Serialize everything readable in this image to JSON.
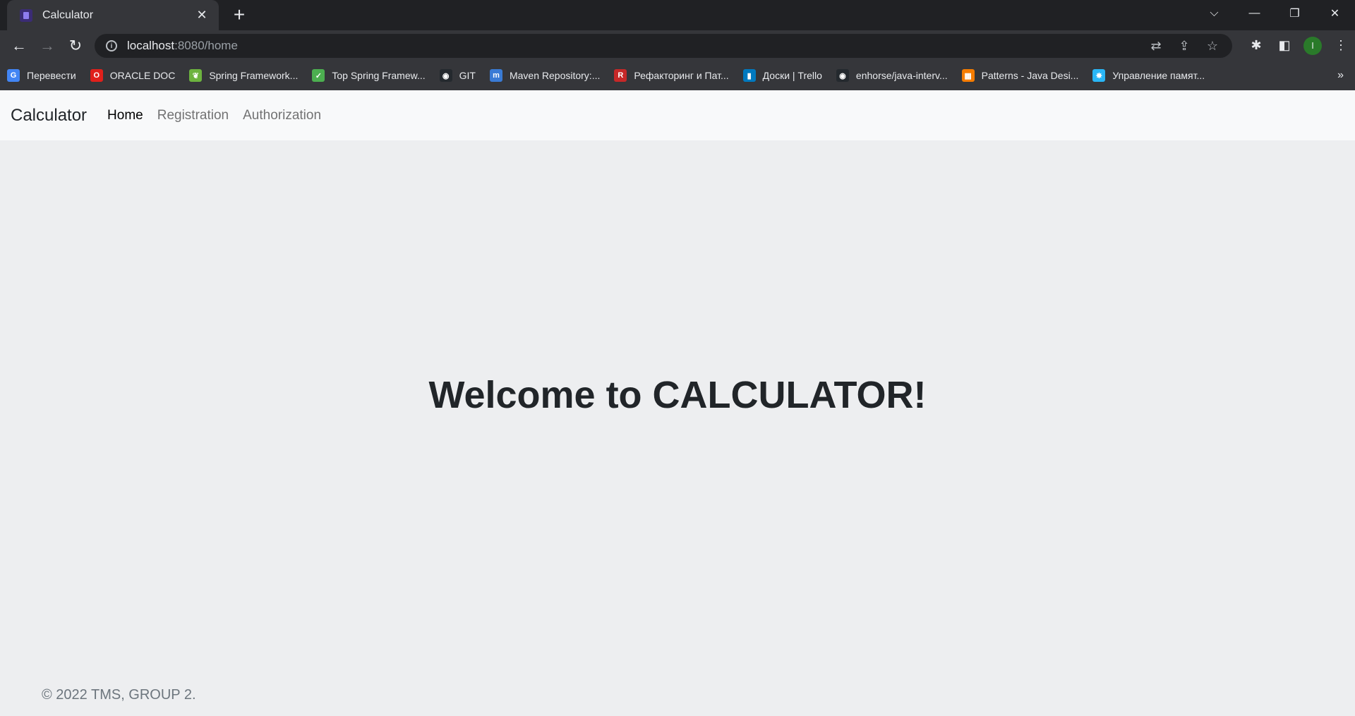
{
  "browser": {
    "tab": {
      "title": "Calculator",
      "close_glyph": "✕"
    },
    "new_tab_glyph": "+",
    "window_buttons": {
      "tab_search": "⌵",
      "minimize": "—",
      "restore": "❐",
      "close": "✕"
    },
    "nav": {
      "back": "←",
      "forward": "→",
      "reload": "↻"
    },
    "address": {
      "host": "localhost",
      "rest": ":8080/home"
    },
    "omnibox_icons": {
      "translate": "⇄",
      "share": "⇪",
      "star": "☆"
    },
    "toolbar_icons": {
      "extensions": "✱",
      "side_panel": "◧",
      "menu": "⋮"
    },
    "profile_initial": "I",
    "bookmarks": [
      {
        "label": "Перевести",
        "icon": "translate-icon",
        "color": "#4285f4",
        "glyph": "G"
      },
      {
        "label": "ORACLE DOC",
        "icon": "oracle-icon",
        "color": "#e0201b",
        "glyph": "O"
      },
      {
        "label": "Spring Framework...",
        "icon": "spring-icon",
        "color": "#6db33f",
        "glyph": "❦"
      },
      {
        "label": "Top Spring Framew...",
        "icon": "leaf-icon",
        "color": "#4caf50",
        "glyph": "✓"
      },
      {
        "label": "GIT",
        "icon": "github-icon",
        "color": "#24292e",
        "glyph": "◉"
      },
      {
        "label": "Maven Repository:...",
        "icon": "maven-icon",
        "color": "#3a7bd5",
        "glyph": "m"
      },
      {
        "label": "Рефакторинг и Пат...",
        "icon": "refactoring-icon",
        "color": "#c62828",
        "glyph": "R"
      },
      {
        "label": "Доски | Trello",
        "icon": "trello-icon",
        "color": "#0079bf",
        "glyph": "▮"
      },
      {
        "label": "enhorse/java-interv...",
        "icon": "github-icon",
        "color": "#24292e",
        "glyph": "◉"
      },
      {
        "label": "Patterns - Java Desi...",
        "icon": "patterns-icon",
        "color": "#f57c00",
        "glyph": "▦"
      },
      {
        "label": "Управление памят...",
        "icon": "memory-icon",
        "color": "#29b6f6",
        "glyph": "✸"
      }
    ],
    "bookmarks_more": "»"
  },
  "page": {
    "brand": "Calculator",
    "nav_links": {
      "home": "Home",
      "registration": "Registration",
      "authorization": "Authorization"
    },
    "heading": "Welcome to CALCULATOR!",
    "footer": "© 2022 TMS, GROUP 2."
  }
}
